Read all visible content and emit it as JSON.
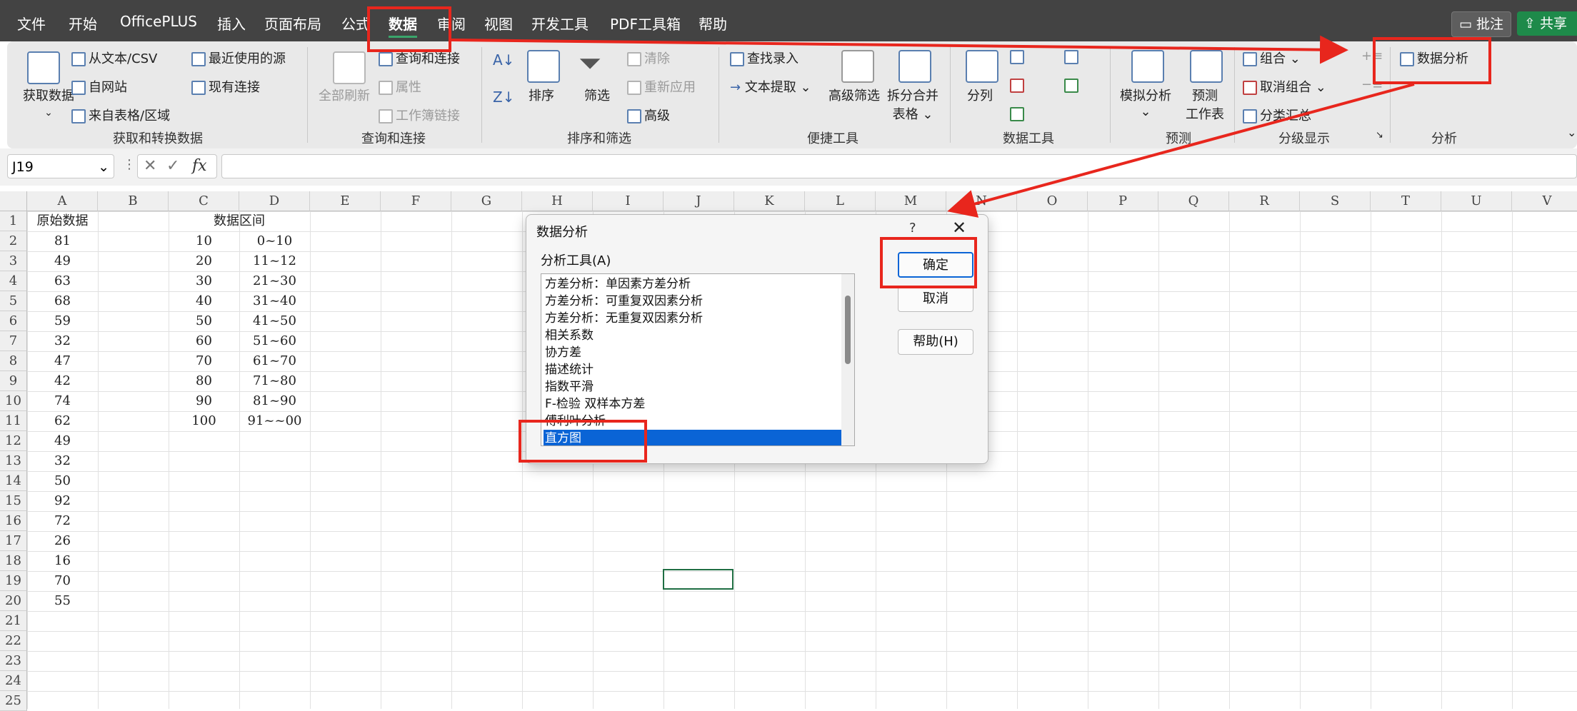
{
  "menu": {
    "tabs": [
      "文件",
      "开始",
      "OfficePLUS",
      "插入",
      "页面布局",
      "公式",
      "数据",
      "审阅",
      "视图",
      "开发工具",
      "PDF工具箱",
      "帮助"
    ],
    "active_tab": "数据",
    "comment_button": "批注",
    "share_button": "共享"
  },
  "ribbon": {
    "get_data": {
      "big_button": "获取数据",
      "from_text_csv": "从文本/CSV",
      "from_web": "自网站",
      "from_table": "来自表格/区域",
      "recent_sources": "最近使用的源",
      "existing_connections": "现有连接",
      "group_label": "获取和转换数据"
    },
    "queries": {
      "refresh_all": "全部刷新",
      "queries_connections": "查询和连接",
      "properties": "属性",
      "workbook_links": "工作簿链接",
      "group_label": "查询和连接"
    },
    "sort_filter": {
      "sort": "排序",
      "filter": "筛选",
      "clear": "清除",
      "reapply": "重新应用",
      "advanced": "高级",
      "group_label": "排序和筛选"
    },
    "quick_tools": {
      "lookup_entry": "查找录入",
      "text_extract": "文本提取",
      "advanced_filter": "高级筛选",
      "split_merge": "拆分合并",
      "split_merge_2": "表格",
      "group_label": "便捷工具"
    },
    "data_tools": {
      "split_columns": "分列",
      "group_label": "数据工具"
    },
    "forecast": {
      "what_if": "模拟分析",
      "forecast_sheet": "预测",
      "forecast_sheet_2": "工作表",
      "group_label": "预测"
    },
    "outline": {
      "group": "组合",
      "ungroup": "取消组合",
      "subtotal": "分类汇总",
      "group_label": "分级显示"
    },
    "analysis": {
      "data_analysis": "数据分析",
      "group_label": "分析"
    }
  },
  "formula_bar": {
    "name_box": "J19",
    "fx": "fx",
    "formula": ""
  },
  "sheet": {
    "columns": [
      "A",
      "B",
      "C",
      "D",
      "E",
      "F",
      "G",
      "H",
      "I",
      "J",
      "K",
      "L",
      "M",
      "N",
      "O",
      "P",
      "Q",
      "R",
      "S",
      "T",
      "U",
      "V"
    ],
    "rows": [
      "1",
      "2",
      "3",
      "4",
      "5",
      "6",
      "7",
      "8",
      "9",
      "10",
      "11",
      "12",
      "13",
      "14",
      "15",
      "16",
      "17",
      "18",
      "19",
      "20",
      "21",
      "22",
      "23",
      "24",
      "25"
    ],
    "header_A": "原始数据",
    "header_CD": "数据区间",
    "col_A": [
      "81",
      "49",
      "63",
      "68",
      "59",
      "32",
      "47",
      "42",
      "74",
      "62",
      "49",
      "32",
      "50",
      "92",
      "72",
      "26",
      "16",
      "70",
      "55"
    ],
    "col_C": [
      "10",
      "20",
      "30",
      "40",
      "50",
      "60",
      "70",
      "80",
      "90",
      "100"
    ],
    "col_D": [
      "0~10",
      "11~12",
      "21~30",
      "31~40",
      "41~50",
      "51~60",
      "61~70",
      "71~80",
      "81~90",
      "91~~00"
    ],
    "selected_cell": "J19"
  },
  "dialog": {
    "title": "数据分析",
    "help_glyph": "?",
    "close_glyph": "✕",
    "tools_label": "分析工具(A)",
    "tools": [
      "方差分析：单因素方差分析",
      "方差分析：可重复双因素分析",
      "方差分析：无重复双因素分析",
      "相关系数",
      "协方差",
      "描述统计",
      "指数平滑",
      "F-检验 双样本方差",
      "傅利叶分析",
      "直方图"
    ],
    "selected_tool": "直方图",
    "ok": "确定",
    "cancel": "取消",
    "help": "帮助(H)"
  },
  "colors": {
    "menubar": "#434343",
    "ribbon": "#e9e9e9",
    "accent_green": "#1f6e43",
    "selection_blue": "#0a64d6",
    "annotation_red": "#e8261d"
  }
}
